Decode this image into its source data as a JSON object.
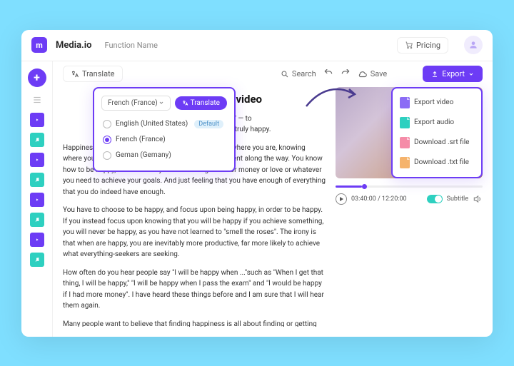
{
  "header": {
    "brand": "Media.io",
    "function_label": "Function Name",
    "pricing_label": "Pricing"
  },
  "toolbar": {
    "translate_label": "Translate",
    "search_label": "Search",
    "save_label": "Save",
    "export_label": "Export"
  },
  "translate_panel": {
    "selected": "French (France)",
    "action": "Translate",
    "options": [
      {
        "label": "English (United States)",
        "default": true,
        "selected": false
      },
      {
        "label": "French (France)",
        "default": false,
        "selected": true
      },
      {
        "label": "Geman (Gemany)",
        "default": false,
        "selected": false
      }
    ],
    "default_badge": "Default"
  },
  "export_panel": {
    "items": [
      {
        "label": "Export video"
      },
      {
        "label": "Export audio"
      },
      {
        "label": "Download .srt file"
      },
      {
        "label": "Download .txt file"
      }
    ]
  },
  "document": {
    "heading_suffix": "ribe Upload a video",
    "p1_tail": "e to \"smell the roses\" — to",
    "p1_tail2": "This is part of being truly happy.",
    "p2": "Happiness is a state of mind. It starts with accepting where you are, knowing where you are going and planning to enjoy every moment along the way. You know how to be happy, and feel that you have enough time or money or love or whatever you need to achieve your goals. And just feeling that you have enough of everything that you do indeed have enough.",
    "p3": "You have to choose to be happy, and focus upon being happy, in order to be happy. If you instead focus upon knowing that you will be happy if you achieve something, you will never be happy, as you have not learned to \"smell the roses\". The irony is that when are happy, you are inevitably more productive,  far more likely to achieve what everything-seekers are seeking.",
    "p4": "How often do you hear people say \"I will be happy when ...\"such as \"When I get that thing, I will be happy,\" \"I will be happy when I pass the exam\" and \"I would be happy if I had more money\". I have heard these things before and I am sure that I will hear them again.",
    "p5": "Many people want to believe that finding happiness is all about finding or getting something that they want. However, not many people have ever found long-term"
  },
  "player": {
    "time": "03:40:00 / 12:20:00",
    "subtitle_label": "Subtitle"
  }
}
